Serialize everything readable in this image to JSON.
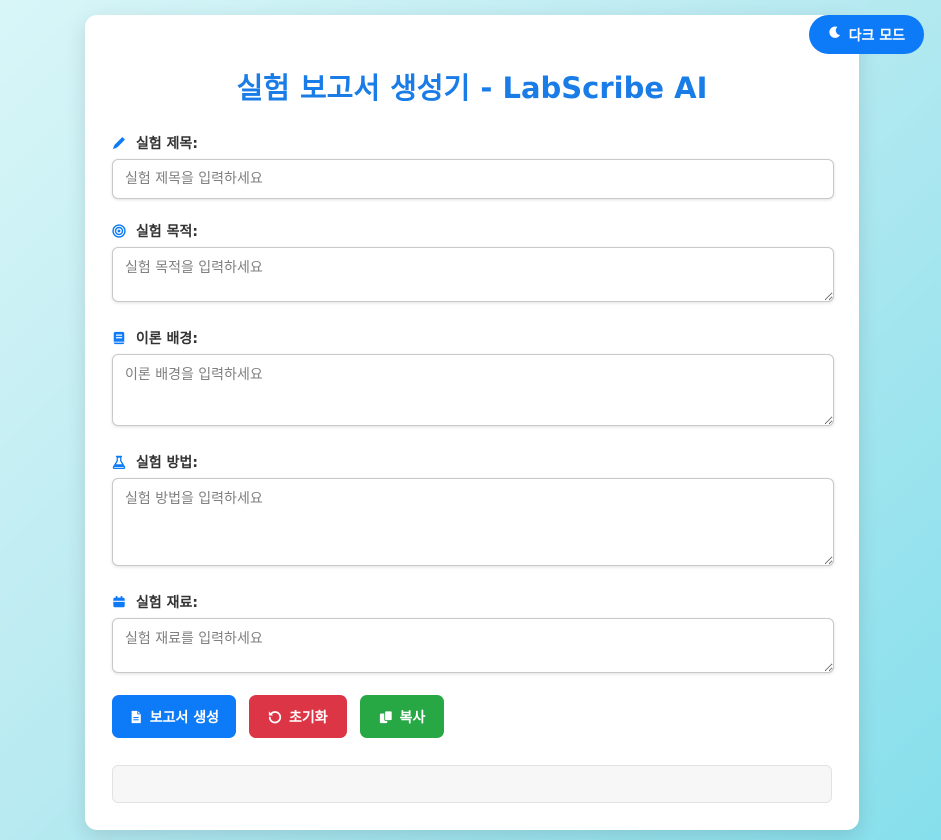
{
  "dark_mode_label": "다크 모드",
  "title": "실험 보고서 생성기 - LabScribe AI",
  "fields": {
    "title": {
      "label": "실험 제목:",
      "placeholder": "실험 제목을 입력하세요",
      "icon": "pencil-icon"
    },
    "purpose": {
      "label": "실험 목적:",
      "placeholder": "실험 목적을 입력하세요",
      "icon": "target-icon"
    },
    "theory": {
      "label": "이론 배경:",
      "placeholder": "이론 배경을 입력하세요",
      "icon": "book-icon"
    },
    "method": {
      "label": "실험 방법:",
      "placeholder": "실험 방법을 입력하세요",
      "icon": "flask-icon"
    },
    "materials": {
      "label": "실험 재료:",
      "placeholder": "실험 재료를 입력하세요",
      "icon": "box-icon"
    }
  },
  "buttons": {
    "generate": "보고서 생성",
    "reset": "초기화",
    "copy": "복사"
  },
  "output": "",
  "colors": {
    "accent": "#0d7bf7",
    "danger": "#dc3545",
    "success": "#28a745",
    "title": "#1a7ce6"
  }
}
